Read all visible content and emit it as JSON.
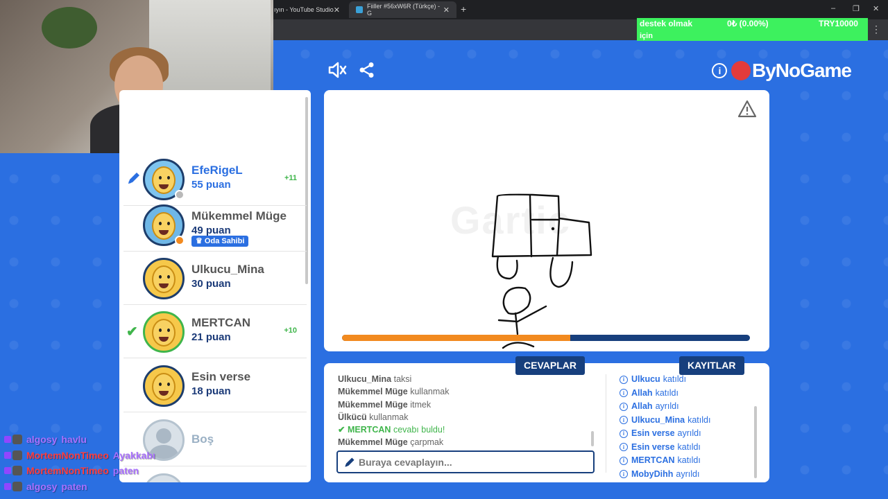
{
  "browser": {
    "tabs": [
      {
        "label": "ıyın - YouTube Studio"
      },
      {
        "label": "Fiiller #56xW6R (Türkçe) - G"
      }
    ],
    "new_tab": "+",
    "controls": {
      "minimize": "–",
      "restore": "❐",
      "close": "✕"
    },
    "menu": "⋮"
  },
  "donation": {
    "label_line1": "destek olmak",
    "label_line2": "için",
    "progress": "0₺ (0.00%)",
    "goal": "TRY10000"
  },
  "header": {
    "sound_icon": "speaker-mute-icon",
    "share_icon": "share-icon",
    "brand": "ByNoGame"
  },
  "players": [
    {
      "name": "EfeRigeL",
      "score": "55 puan",
      "delta": "+11",
      "role": "drawing",
      "status_color": "#b9b9b9"
    },
    {
      "name": "Mükemmel Müge",
      "score": "49 puan",
      "badge": "Oda Sahibi",
      "status_color": "#f28a1f"
    },
    {
      "name": "Ulkucu_Mina",
      "score": "30 puan"
    },
    {
      "name": "MERTCAN",
      "score": "21 puan",
      "delta": "+10",
      "role": "guessed"
    },
    {
      "name": "Esin verse",
      "score": "18 puan"
    },
    {
      "name": "Boş"
    }
  ],
  "canvas": {
    "watermark": "Gartic",
    "timer_fraction": 0.56,
    "colors": {
      "timer_fill": "#f28a1f",
      "timer_track": "#173f7d"
    }
  },
  "tabs": {
    "answers": "CEVAPLAR",
    "logs": "KAYITLAR"
  },
  "answers": [
    {
      "user": "Ulkucu_Mina",
      "text": "taksi"
    },
    {
      "user": "Mükemmel Müge",
      "text": "kullanmak"
    },
    {
      "user": "Mükemmel Müge",
      "text": "itmek"
    },
    {
      "user": "Ülkücü",
      "text": "kullanmak"
    },
    {
      "user": "MERTCAN",
      "text": "cevabı buldu!",
      "correct": true
    },
    {
      "user": "Mükemmel Müge",
      "text": "çarpmak"
    }
  ],
  "input": {
    "placeholder": "Buraya cevaplayın..."
  },
  "logs": [
    {
      "user": "Ulkucu",
      "text": "katıldı"
    },
    {
      "user": "Allah",
      "text": "katıldı"
    },
    {
      "user": "Allah",
      "text": "ayrıldı"
    },
    {
      "user": "Ulkucu_Mina",
      "text": "katıldı"
    },
    {
      "user": "Esin verse",
      "text": "ayrıldı"
    },
    {
      "user": "Esin verse",
      "text": "katıldı"
    },
    {
      "user": "MERTCAN",
      "text": "katıldı"
    },
    {
      "user": "MobyDihh",
      "text": "ayrıldı"
    }
  ],
  "twitch_chat": [
    {
      "user": "algosy",
      "text": "havlu",
      "color": "#a970ff"
    },
    {
      "user": "MortemNonTimeo",
      "text": "Ayakkabı",
      "color": "#ff3d3d"
    },
    {
      "user": "MortemNonTimeo",
      "text": "paten",
      "color": "#ff3d3d"
    },
    {
      "user": "algosy",
      "text": "paten",
      "color": "#a970ff"
    }
  ]
}
